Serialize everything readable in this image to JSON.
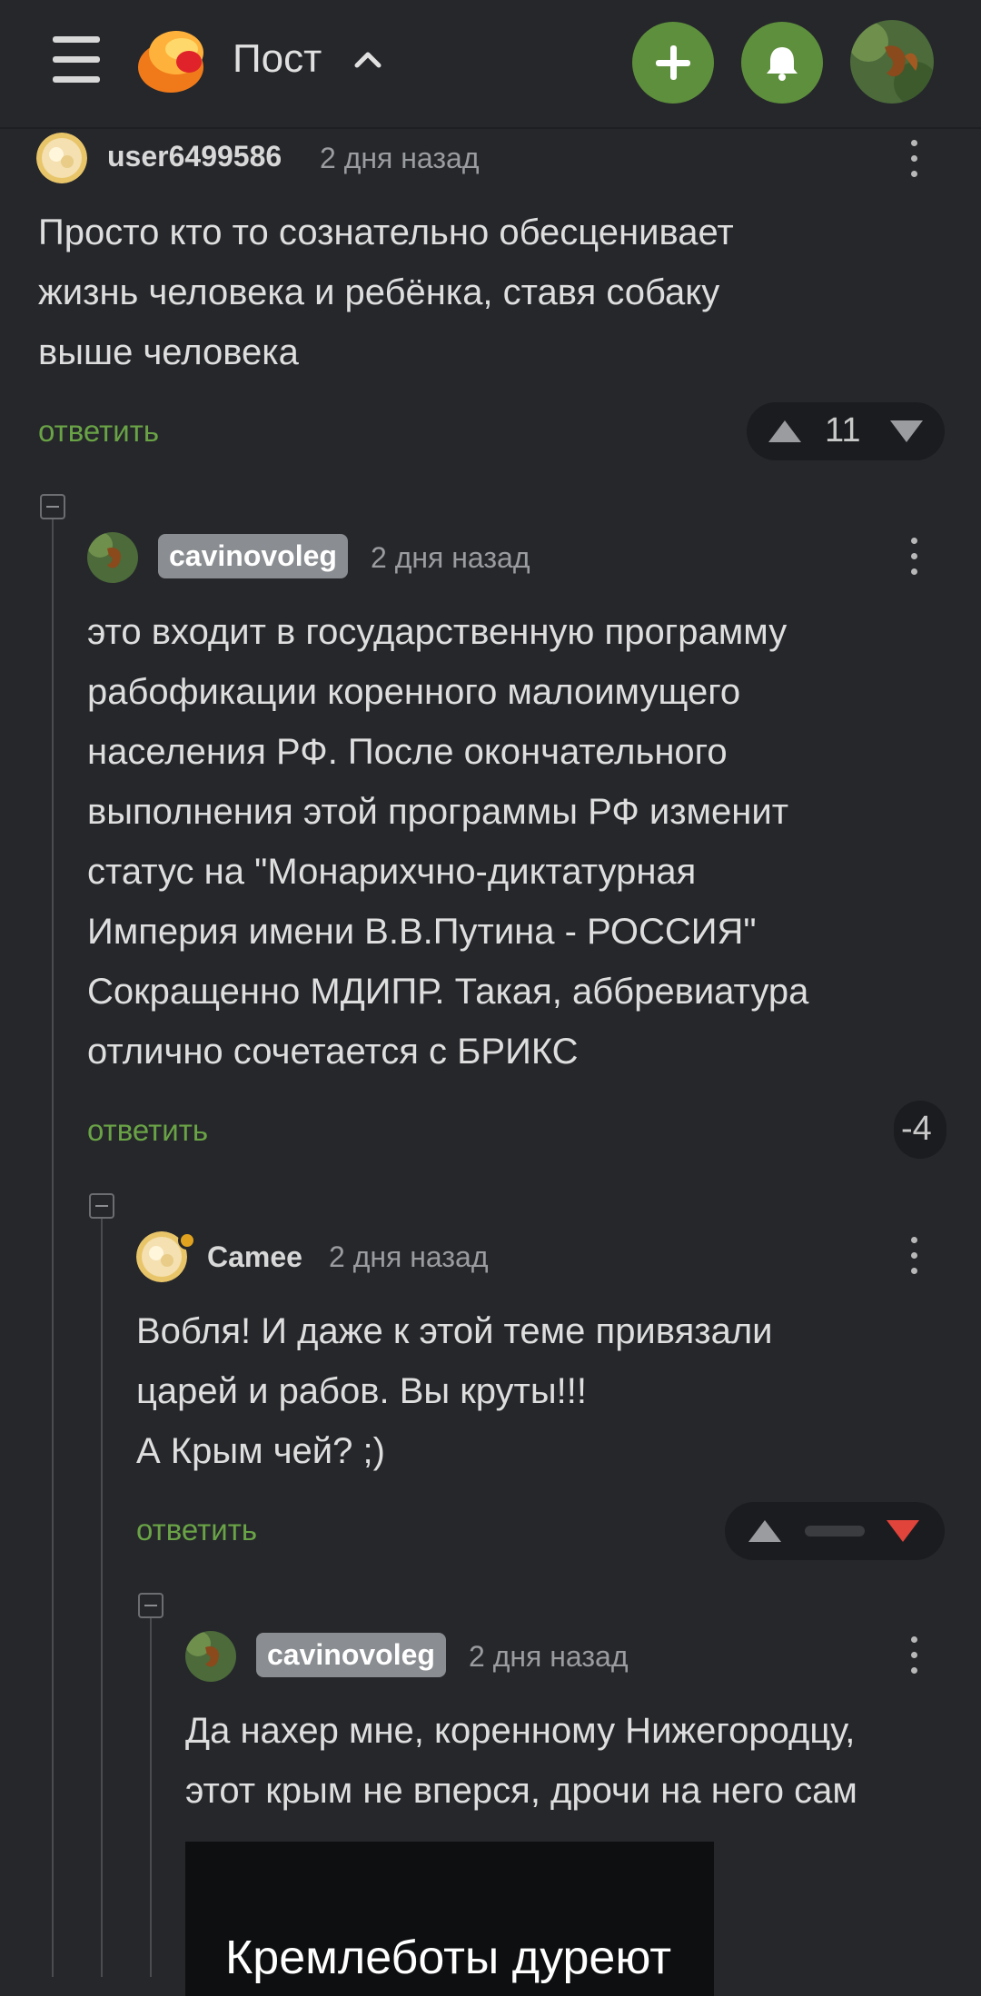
{
  "header": {
    "title": "Пост",
    "icons": [
      "menu-icon",
      "logo-icon",
      "chevron-up-icon",
      "plus-icon",
      "bell-icon",
      "user-avatar"
    ]
  },
  "colors": {
    "background": "#25272b",
    "accent_green": "#5e8f3c",
    "reply_green": "#6aa346",
    "downvote_red": "#e0443b"
  },
  "comments": [
    {
      "user": "user6499586",
      "time": "2 дня назад",
      "text": "Просто кто то сознательно обесценивает\nжизнь человека и ребёнка, ставя собаку\nвыше человека",
      "reply": "ответить",
      "rating": "11"
    },
    {
      "user": "cavinovoleg",
      "time": "2 дня назад",
      "text": "это входит в государственную программу\nрабофикации коренного малоимущего\nнаселения РФ. После окончательного\nвыполнения этой программы РФ изменит\nстатус на \"Монарихчно-диктатурная\nИмперия имени В.В.Путина - РОССИЯ\"\nСокращенно МДИПР. Такая, аббревиатура\nотлично сочетается с БРИКС",
      "reply": "ответить",
      "rating": "-4"
    },
    {
      "user": "Camee",
      "time": "2 дня назад",
      "text": "Вобля! И даже к этой теме привязали\nцарей и рабов. Вы круты!!!\nА Крым чей? ;)",
      "reply": "ответить"
    },
    {
      "user": "cavinovoleg",
      "time": "2 дня назад",
      "text": "Да нахер мне, коренному Нижегородцу,\nэтот крым не вперся, дрочи на него сам",
      "image_caption": "Кремлеботы дуреют"
    }
  ]
}
